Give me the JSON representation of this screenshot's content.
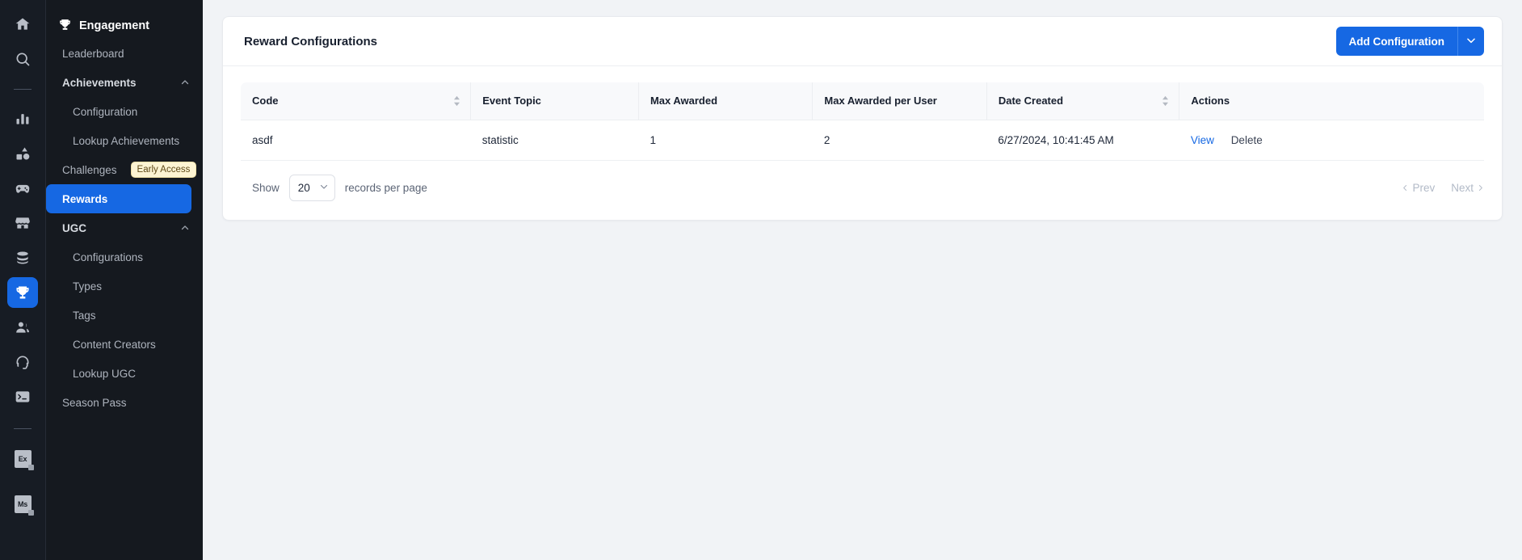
{
  "rail": {
    "items": [
      {
        "name": "home-icon",
        "label": "Home"
      },
      {
        "name": "search-icon",
        "label": "Search"
      },
      {
        "name": "divider-1",
        "label": "divider"
      },
      {
        "name": "bar-chart-icon",
        "label": "Analytics"
      },
      {
        "name": "shapes-icon",
        "label": "Assets"
      },
      {
        "name": "gamepad-icon",
        "label": "Games"
      },
      {
        "name": "store-icon",
        "label": "Store"
      },
      {
        "name": "database-icon",
        "label": "Data"
      },
      {
        "name": "trophy-icon",
        "label": "Engagement"
      },
      {
        "name": "users-icon",
        "label": "Users"
      },
      {
        "name": "headset-icon",
        "label": "Support"
      },
      {
        "name": "terminal-icon",
        "label": "Console"
      },
      {
        "name": "divider-2",
        "label": "divider"
      },
      {
        "name": "file-ex-icon",
        "label": "Ex"
      },
      {
        "name": "file-ms-icon",
        "label": "Ms"
      }
    ],
    "active_index": 8,
    "file_labels": {
      "ex": "Ex",
      "ms": "Ms"
    }
  },
  "sidebar": {
    "title": "Engagement",
    "items": [
      {
        "label": "Leaderboard",
        "type": "item"
      },
      {
        "label": "Achievements",
        "type": "group",
        "expanded": true
      },
      {
        "label": "Configuration",
        "type": "sub"
      },
      {
        "label": "Lookup Achievements",
        "type": "sub"
      },
      {
        "label": "Challenges",
        "type": "item",
        "badge": "Early Access"
      },
      {
        "label": "Rewards",
        "type": "item",
        "active": true
      },
      {
        "label": "UGC",
        "type": "group",
        "expanded": true
      },
      {
        "label": "Configurations",
        "type": "sub"
      },
      {
        "label": "Types",
        "type": "sub"
      },
      {
        "label": "Tags",
        "type": "sub"
      },
      {
        "label": "Content Creators",
        "type": "sub"
      },
      {
        "label": "Lookup UGC",
        "type": "sub"
      },
      {
        "label": "Season Pass",
        "type": "item"
      }
    ]
  },
  "card": {
    "title": "Reward Configurations",
    "add_button": "Add Configuration"
  },
  "table": {
    "columns": [
      {
        "label": "Code",
        "sortable": true
      },
      {
        "label": "Event Topic",
        "sortable": false
      },
      {
        "label": "Max Awarded",
        "sortable": false
      },
      {
        "label": "Max Awarded per User",
        "sortable": false
      },
      {
        "label": "Date Created",
        "sortable": true
      },
      {
        "label": "Actions",
        "sortable": false
      }
    ],
    "rows": [
      {
        "code": "asdf",
        "event_topic": "statistic",
        "max_awarded": "1",
        "max_awarded_per_user": "2",
        "date_created": "6/27/2024, 10:41:45 AM",
        "actions": {
          "view": "View",
          "delete": "Delete"
        }
      }
    ]
  },
  "pagination": {
    "show_label": "Show",
    "page_size": "20",
    "records_label": "records per page",
    "prev": "Prev",
    "next": "Next"
  },
  "colors": {
    "accent": "#1668e3",
    "rail_bg": "#171c24",
    "nav_bg": "#15191f",
    "page_bg": "#f1f3f6",
    "badge_bg": "#fdf4d3",
    "badge_text": "#5f4a18"
  }
}
